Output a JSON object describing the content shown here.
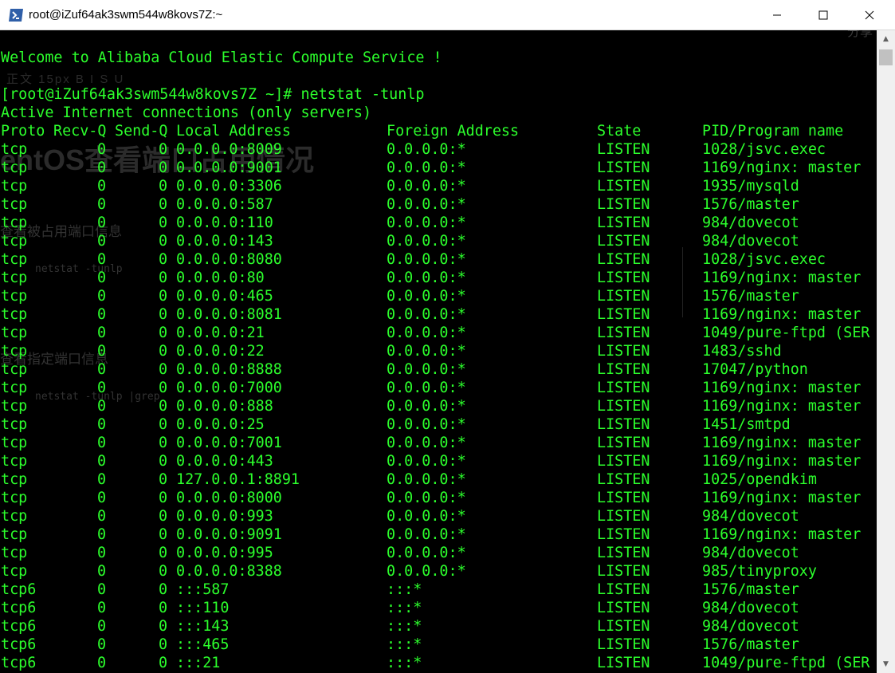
{
  "window": {
    "title": "root@iZuf64ak3swm544w8kovs7Z:~",
    "icon": "powershell-icon",
    "controls": {
      "minimize_icon": "minimize-icon",
      "maximize_icon": "maximize-icon",
      "close_icon": "close-icon"
    }
  },
  "colors": {
    "terminal_text": "#2cff2c",
    "terminal_bg": "#000000",
    "titlebar_bg": "#ffffff"
  },
  "background_ghost": {
    "share": "分享",
    "toolbar": "正文  15px  B  I  S  U",
    "heading": "entOS查看端口占用情况",
    "step1": "查看被占用端口信息",
    "command1": "netstat -tunlp",
    "step2": "查看指定端口信息",
    "command2": "netstat -tunlp |grep"
  },
  "terminal": {
    "welcome": "Welcome to Alibaba Cloud Elastic Compute Service !",
    "prompt": "[root@iZuf64ak3swm544w8kovs7Z ~]# netstat -tunlp",
    "info": "Active Internet connections (only servers)",
    "headers": [
      "Proto",
      "Recv-Q",
      "Send-Q",
      "Local Address",
      "Foreign Address",
      "State",
      "PID/Program name"
    ],
    "rows": [
      [
        "tcp",
        "0",
        "0",
        "0.0.0.0:8009",
        "0.0.0.0:*",
        "LISTEN",
        "1028/jsvc.exec"
      ],
      [
        "tcp",
        "0",
        "0",
        "0.0.0.0:9001",
        "0.0.0.0:*",
        "LISTEN",
        "1169/nginx: master"
      ],
      [
        "tcp",
        "0",
        "0",
        "0.0.0.0:3306",
        "0.0.0.0:*",
        "LISTEN",
        "1935/mysqld"
      ],
      [
        "tcp",
        "0",
        "0",
        "0.0.0.0:587",
        "0.0.0.0:*",
        "LISTEN",
        "1576/master"
      ],
      [
        "tcp",
        "0",
        "0",
        "0.0.0.0:110",
        "0.0.0.0:*",
        "LISTEN",
        "984/dovecot"
      ],
      [
        "tcp",
        "0",
        "0",
        "0.0.0.0:143",
        "0.0.0.0:*",
        "LISTEN",
        "984/dovecot"
      ],
      [
        "tcp",
        "0",
        "0",
        "0.0.0.0:8080",
        "0.0.0.0:*",
        "LISTEN",
        "1028/jsvc.exec"
      ],
      [
        "tcp",
        "0",
        "0",
        "0.0.0.0:80",
        "0.0.0.0:*",
        "LISTEN",
        "1169/nginx: master"
      ],
      [
        "tcp",
        "0",
        "0",
        "0.0.0.0:465",
        "0.0.0.0:*",
        "LISTEN",
        "1576/master"
      ],
      [
        "tcp",
        "0",
        "0",
        "0.0.0.0:8081",
        "0.0.0.0:*",
        "LISTEN",
        "1169/nginx: master"
      ],
      [
        "tcp",
        "0",
        "0",
        "0.0.0.0:21",
        "0.0.0.0:*",
        "LISTEN",
        "1049/pure-ftpd (SER"
      ],
      [
        "tcp",
        "0",
        "0",
        "0.0.0.0:22",
        "0.0.0.0:*",
        "LISTEN",
        "1483/sshd"
      ],
      [
        "tcp",
        "0",
        "0",
        "0.0.0.0:8888",
        "0.0.0.0:*",
        "LISTEN",
        "17047/python"
      ],
      [
        "tcp",
        "0",
        "0",
        "0.0.0.0:7000",
        "0.0.0.0:*",
        "LISTEN",
        "1169/nginx: master"
      ],
      [
        "tcp",
        "0",
        "0",
        "0.0.0.0:888",
        "0.0.0.0:*",
        "LISTEN",
        "1169/nginx: master"
      ],
      [
        "tcp",
        "0",
        "0",
        "0.0.0.0:25",
        "0.0.0.0:*",
        "LISTEN",
        "1451/smtpd"
      ],
      [
        "tcp",
        "0",
        "0",
        "0.0.0.0:7001",
        "0.0.0.0:*",
        "LISTEN",
        "1169/nginx: master"
      ],
      [
        "tcp",
        "0",
        "0",
        "0.0.0.0:443",
        "0.0.0.0:*",
        "LISTEN",
        "1169/nginx: master"
      ],
      [
        "tcp",
        "0",
        "0",
        "127.0.0.1:8891",
        "0.0.0.0:*",
        "LISTEN",
        "1025/opendkim"
      ],
      [
        "tcp",
        "0",
        "0",
        "0.0.0.0:8000",
        "0.0.0.0:*",
        "LISTEN",
        "1169/nginx: master"
      ],
      [
        "tcp",
        "0",
        "0",
        "0.0.0.0:993",
        "0.0.0.0:*",
        "LISTEN",
        "984/dovecot"
      ],
      [
        "tcp",
        "0",
        "0",
        "0.0.0.0:9091",
        "0.0.0.0:*",
        "LISTEN",
        "1169/nginx: master"
      ],
      [
        "tcp",
        "0",
        "0",
        "0.0.0.0:995",
        "0.0.0.0:*",
        "LISTEN",
        "984/dovecot"
      ],
      [
        "tcp",
        "0",
        "0",
        "0.0.0.0:8388",
        "0.0.0.0:*",
        "LISTEN",
        "985/tinyproxy"
      ],
      [
        "tcp6",
        "0",
        "0",
        ":::587",
        ":::*",
        "LISTEN",
        "1576/master"
      ],
      [
        "tcp6",
        "0",
        "0",
        ":::110",
        ":::*",
        "LISTEN",
        "984/dovecot"
      ],
      [
        "tcp6",
        "0",
        "0",
        ":::143",
        ":::*",
        "LISTEN",
        "984/dovecot"
      ],
      [
        "tcp6",
        "0",
        "0",
        ":::465",
        ":::*",
        "LISTEN",
        "1576/master"
      ],
      [
        "tcp6",
        "0",
        "0",
        ":::21",
        ":::*",
        "LISTEN",
        "1049/pure-ftpd (SER"
      ]
    ]
  },
  "scrollbar": {
    "up_icon": "scroll-up-icon",
    "down_icon": "scroll-down-icon"
  }
}
